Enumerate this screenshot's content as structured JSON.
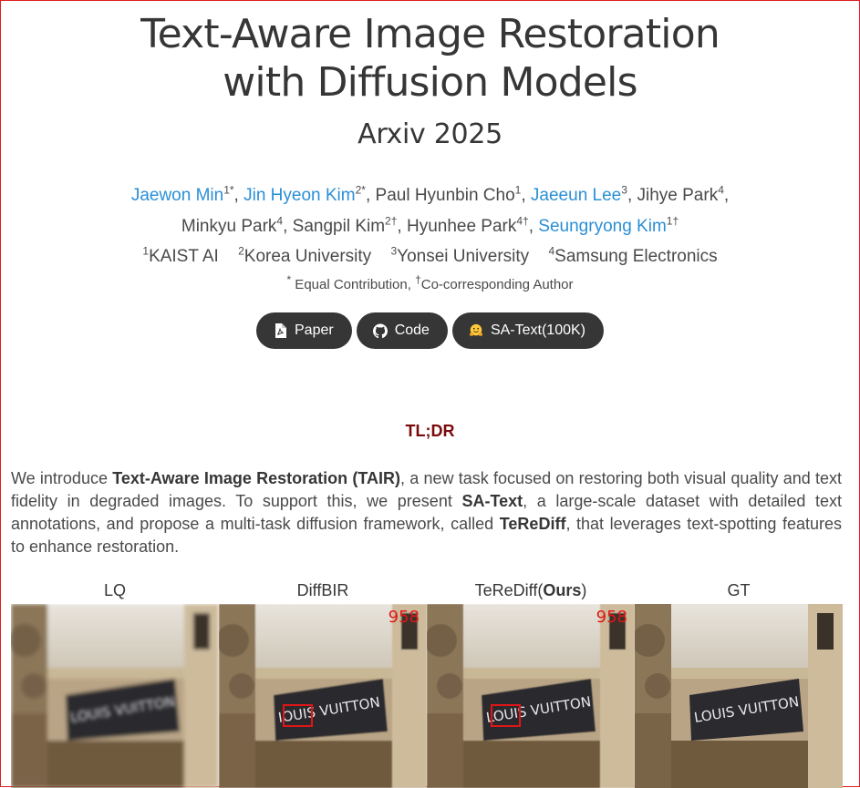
{
  "header": {
    "title_line1": "Text-Aware Image Restoration",
    "title_line2": "with Diffusion Models",
    "venue": "Arxiv 2025"
  },
  "authors": [
    {
      "name": "Jaewon Min",
      "sup": "1*",
      "link": true,
      "sep": ", "
    },
    {
      "name": "Jin Hyeon Kim",
      "sup": "2*",
      "link": true,
      "sep": ", "
    },
    {
      "name": "Paul Hyunbin Cho",
      "sup": "1",
      "link": false,
      "sep": ", "
    },
    {
      "name": "Jaeeun Lee",
      "sup": "3",
      "link": true,
      "sep": ", "
    },
    {
      "name": "Jihye Park",
      "sup": "4",
      "link": false,
      "sep": ","
    },
    {
      "name": "Minkyu Park",
      "sup": "4",
      "link": false,
      "sep": ", "
    },
    {
      "name": "Sangpil Kim",
      "sup": "2†",
      "link": false,
      "sep": ", "
    },
    {
      "name": "Hyunhee Park",
      "sup": "4†",
      "link": false,
      "sep": ", "
    },
    {
      "name": "Seungryong Kim",
      "sup": "1†",
      "link": true,
      "sep": ""
    }
  ],
  "affiliations": [
    {
      "sup": "1",
      "name": "KAIST AI"
    },
    {
      "sup": "2",
      "name": "Korea University"
    },
    {
      "sup": "3",
      "name": "Yonsei University"
    },
    {
      "sup": "4",
      "name": "Samsung Electronics"
    }
  ],
  "notes": {
    "equal_sup": "*",
    "equal_text": " Equal Contribution, ",
    "corr_sup": "†",
    "corr_text": "Co-corresponding Author"
  },
  "buttons": [
    {
      "label": "Paper",
      "icon": "pdf-icon"
    },
    {
      "label": "Code",
      "icon": "github-icon"
    },
    {
      "label": "SA-Text(100K)",
      "icon": "hugging-face-emoji-icon"
    }
  ],
  "tldr": {
    "heading": "TL;DR",
    "parts": [
      {
        "t": "We introduce ",
        "b": false
      },
      {
        "t": "Text-Aware Image Restoration (TAIR)",
        "b": true
      },
      {
        "t": ", a new task focused on restoring both visual quality and text fidelity in degraded images. To support this, we present ",
        "b": false
      },
      {
        "t": "SA-Text",
        "b": true
      },
      {
        "t": ", a large-scale dataset with detailed text annotations, and propose a multi-task diffusion framework, called ",
        "b": false
      },
      {
        "t": "TeReDiff",
        "b": true
      },
      {
        "t": ", that leverages text-spotting features to enhance restoration.",
        "b": false
      }
    ]
  },
  "comparison": {
    "labels": {
      "lq": "LQ",
      "diffbir": "DiffBIR",
      "ours_prefix": "TeReDiff(",
      "ours_bold": "Ours",
      "ours_suffix": ")",
      "gt": "GT"
    },
    "panels": [
      {
        "id": "lq",
        "badge": "",
        "sign_text": "LOUIS VUITTON",
        "has_box": false
      },
      {
        "id": "diffbir",
        "badge": "958",
        "sign_text": "IOUIS VUITTON",
        "has_box": true
      },
      {
        "id": "ours",
        "badge": "958",
        "sign_text": "LOUIS VUITTON",
        "has_box": true
      },
      {
        "id": "gt",
        "badge": "",
        "sign_text": "LOUIS VUITTON",
        "has_box": false
      }
    ]
  },
  "colors": {
    "link": "#2a8fd6",
    "button_bg": "#363636",
    "tldr": "#7a0a0a",
    "badge": "#e01616",
    "frame_border": "#e11d1d"
  }
}
